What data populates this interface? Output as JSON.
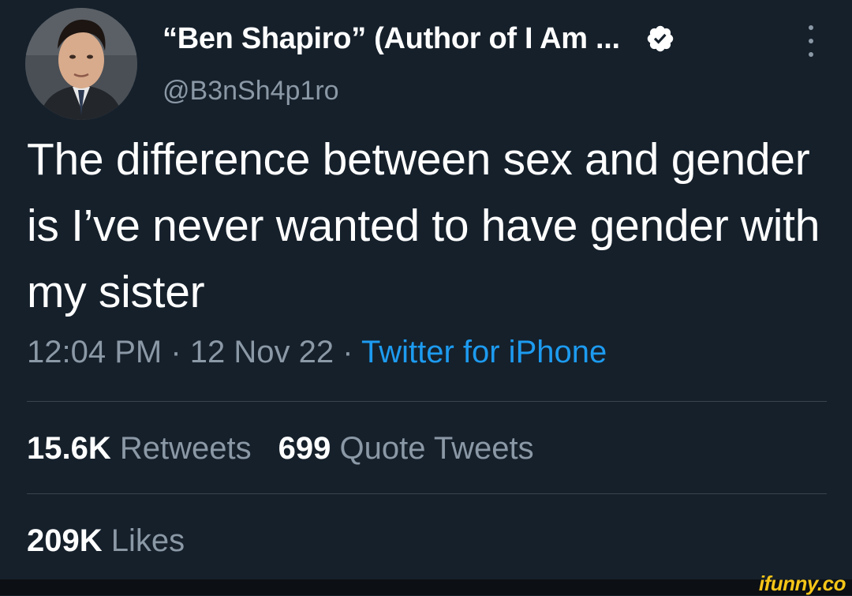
{
  "tweet": {
    "author": {
      "display_name": "“Ben Shapiro” (Author of I Am ...",
      "handle": "@B3nSh4p1ro",
      "verified": true
    },
    "text": "The difference between sex and gender is I’ve never wanted to have gender with my sister",
    "time": "12:04 PM",
    "date": "12 Nov 22",
    "separator": "·",
    "source": "Twitter for iPhone",
    "stats": {
      "retweets_count": "15.6K",
      "retweets_label": "Retweets",
      "quotes_count": "699",
      "quotes_label": "Quote Tweets",
      "likes_count": "209K",
      "likes_label": "Likes"
    }
  },
  "watermark": "ifunny.co",
  "colors": {
    "background": "#15202b",
    "secondary_text": "#8b98a5",
    "accent": "#1d9bf0",
    "divider": "#38444d"
  },
  "icons": [
    "avatar-photo",
    "verified-badge-icon",
    "more-options-icon"
  ]
}
